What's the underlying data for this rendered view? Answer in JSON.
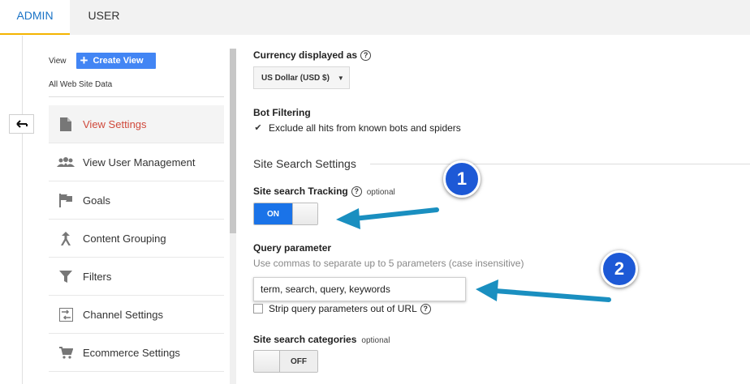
{
  "tabs": {
    "admin": "ADMIN",
    "user": "USER"
  },
  "view": {
    "label": "View",
    "create_button": "Create View",
    "subtitle": "All Web Site Data"
  },
  "nav": [
    {
      "label": "View Settings",
      "icon": "document-icon",
      "active": true
    },
    {
      "label": "View User Management",
      "icon": "users-icon",
      "active": false
    },
    {
      "label": "Goals",
      "icon": "flag-icon",
      "active": false
    },
    {
      "label": "Content Grouping",
      "icon": "content-grouping-icon",
      "active": false
    },
    {
      "label": "Filters",
      "icon": "filter-icon",
      "active": false
    },
    {
      "label": "Channel Settings",
      "icon": "channel-settings-icon",
      "active": false
    },
    {
      "label": "Ecommerce Settings",
      "icon": "cart-icon",
      "active": false
    }
  ],
  "currency": {
    "label": "Currency displayed as",
    "help": "?",
    "value": "US Dollar (USD $)"
  },
  "bot": {
    "label": "Bot Filtering",
    "checkbox_label": "Exclude all hits from known bots and spiders",
    "checked": true
  },
  "site_search": {
    "section_title": "Site Search Settings",
    "tracking_label": "Site search Tracking",
    "tracking_optional": "optional",
    "tracking_toggle": "ON",
    "query_label": "Query parameter",
    "query_hint": "Use commas to separate up to 5 parameters (case insensitive)",
    "query_value": "term, search, query, keywords",
    "strip_label": "Strip query parameters out of URL",
    "strip_checked": false,
    "categories_label": "Site search categories",
    "categories_optional": "optional",
    "categories_toggle": "OFF"
  },
  "callouts": {
    "one": "1",
    "two": "2"
  },
  "colors": {
    "accent_blue": "#1a73e8",
    "active_nav": "#d0493b",
    "tab_underline": "#f4b400",
    "callout_arrow": "#1a8fc0"
  }
}
